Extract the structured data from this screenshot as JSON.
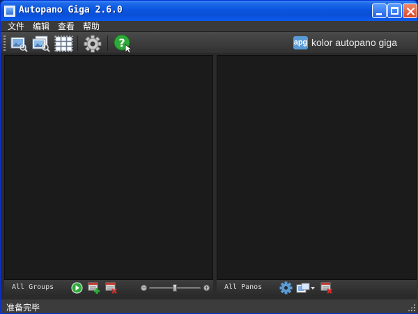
{
  "window": {
    "title": "Autopano Giga 2.6.0"
  },
  "menu": {
    "items": [
      "文件",
      "编辑",
      "查看",
      "帮助"
    ]
  },
  "toolbar": {
    "buttons": [
      {
        "icon": "select-folder-icon"
      },
      {
        "icon": "import-images-icon"
      },
      {
        "icon": "detect-panoramas-icon"
      },
      {
        "icon": "settings-gear-icon"
      },
      {
        "icon": "help-icon"
      }
    ]
  },
  "brand": {
    "badge": "apg",
    "text": "kolor autopano giga",
    "badge_color": "#5b9bd5"
  },
  "groups_panel": {
    "label": "All Groups"
  },
  "panos_panel": {
    "label": "All Panos"
  },
  "status": {
    "text": "准备完毕"
  },
  "colors": {
    "background": "#2b2b2b",
    "panel": "#1b1b1b",
    "title_blue": "#0b56e0",
    "run_green": "#2faa3a",
    "remove_red": "#d32f2f"
  }
}
